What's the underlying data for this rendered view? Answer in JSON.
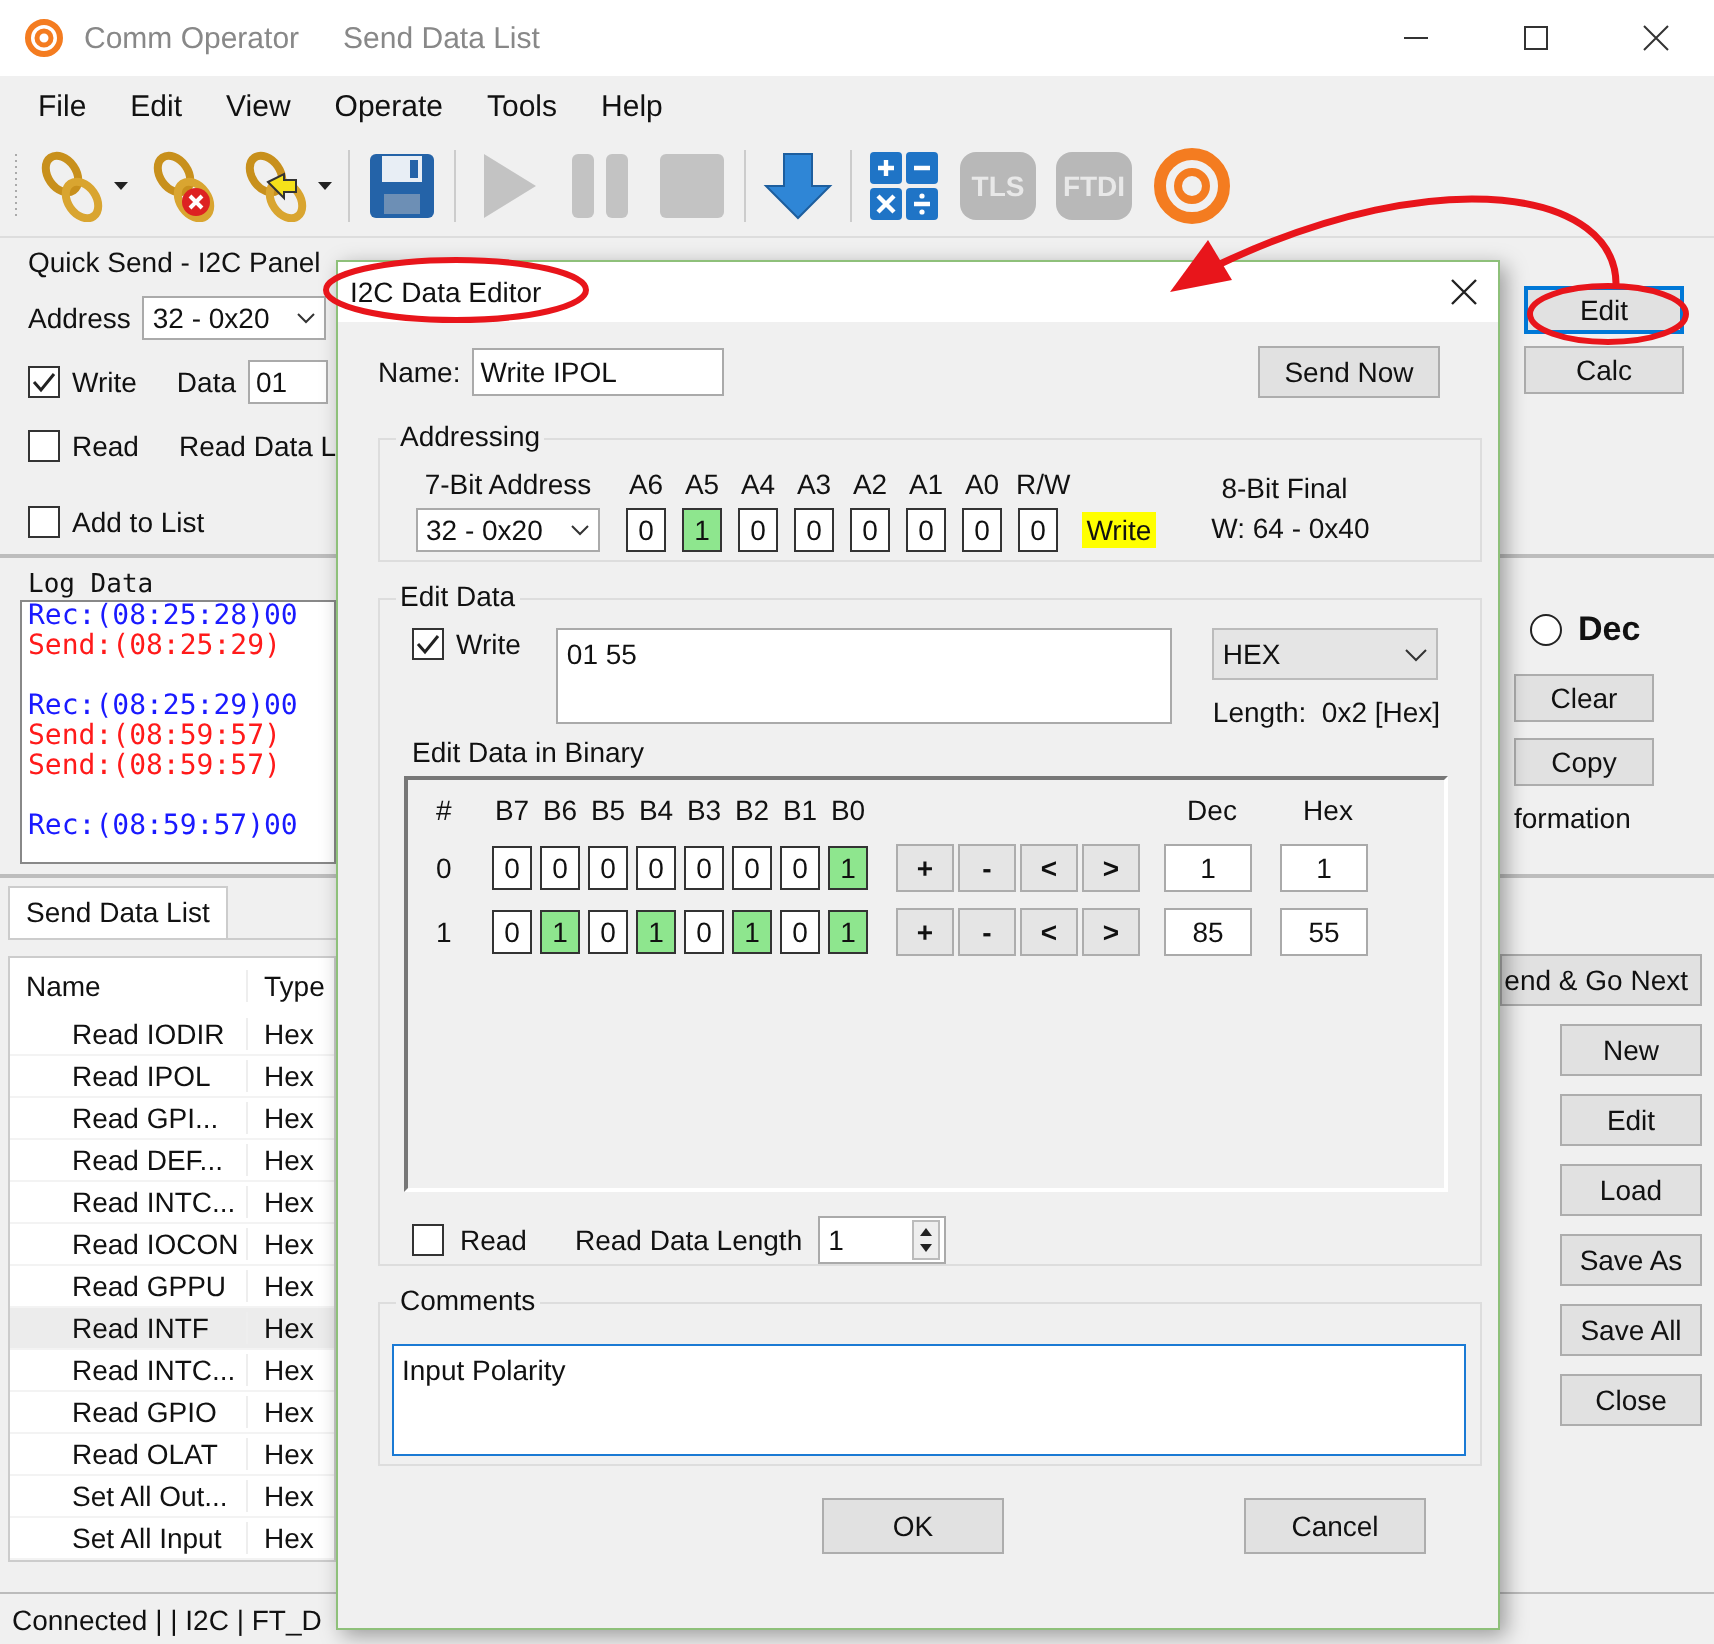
{
  "window": {
    "app_name": "Comm Operator",
    "title": "Send Data List"
  },
  "menu": [
    "File",
    "Edit",
    "View",
    "Operate",
    "Tools",
    "Help"
  ],
  "toolbar": [
    {
      "kind": "connect",
      "dropdown": true,
      "disabled": false
    },
    {
      "kind": "disconnect",
      "dropdown": false,
      "disabled": false
    },
    {
      "kind": "reconnect",
      "dropdown": true,
      "disabled": false
    },
    {
      "kind": "separator"
    },
    {
      "kind": "save",
      "dropdown": false,
      "disabled": false
    },
    {
      "kind": "separator"
    },
    {
      "kind": "play",
      "dropdown": false,
      "disabled": true
    },
    {
      "kind": "pause",
      "dropdown": false,
      "disabled": true
    },
    {
      "kind": "stop",
      "dropdown": false,
      "disabled": true
    },
    {
      "kind": "separator"
    },
    {
      "kind": "download",
      "dropdown": false,
      "disabled": false
    },
    {
      "kind": "separator"
    },
    {
      "kind": "calculator",
      "dropdown": false,
      "disabled": false
    },
    {
      "kind": "badge",
      "label": "TLS",
      "dropdown": false,
      "disabled": true
    },
    {
      "kind": "badge",
      "label": "FTDI",
      "dropdown": false,
      "disabled": true
    },
    {
      "kind": "logo",
      "dropdown": false,
      "disabled": false
    }
  ],
  "quick_send": {
    "title": "Quick Send - I2C Panel",
    "address_label": "Address",
    "address": "32 - 0x20",
    "write": {
      "label": "Write",
      "checked": true
    },
    "data_label": "Data",
    "data": "01",
    "read": {
      "label": "Read",
      "checked": false
    },
    "read_length_label": "Read Data L",
    "add_to_list": {
      "label": "Add to List",
      "checked": false
    }
  },
  "side_buttons": [
    {
      "label": "Edit",
      "focused": true
    },
    {
      "label": "Calc",
      "focused": false
    }
  ],
  "log": {
    "title": "Log Data",
    "lines": [
      {
        "kind": "rec",
        "text": "Rec:(08:25:28)00",
        "gap_before": false
      },
      {
        "kind": "send",
        "text": "Send:(08:25:29)",
        "gap_before": false
      },
      {
        "kind": "rec",
        "text": "Rec:(08:25:29)00",
        "gap_before": true
      },
      {
        "kind": "send",
        "text": "Send:(08:59:57)",
        "gap_before": false
      },
      {
        "kind": "send",
        "text": "Send:(08:59:57)",
        "gap_before": false
      },
      {
        "kind": "rec",
        "text": "Rec:(08:59:57)00",
        "gap_before": true
      }
    ],
    "format": {
      "label": "Dec",
      "selected": false
    },
    "buttons": [
      "Clear",
      "Copy"
    ],
    "info_text": "formation"
  },
  "send_list": {
    "tab": "Send Data List",
    "columns": [
      "Name",
      "Type"
    ],
    "rows": [
      {
        "name": "Read IODIR",
        "type": "Hex",
        "selected": false
      },
      {
        "name": "Read IPOL",
        "type": "Hex",
        "selected": false
      },
      {
        "name": "Read GPI...",
        "type": "Hex",
        "selected": false
      },
      {
        "name": "Read DEF...",
        "type": "Hex",
        "selected": false
      },
      {
        "name": "Read INTC...",
        "type": "Hex",
        "selected": false
      },
      {
        "name": "Read IOCON",
        "type": "Hex",
        "selected": false
      },
      {
        "name": "Read GPPU",
        "type": "Hex",
        "selected": false
      },
      {
        "name": "Read INTF",
        "type": "Hex",
        "selected": true
      },
      {
        "name": "Read INTC...",
        "type": "Hex",
        "selected": false
      },
      {
        "name": "Read GPIO",
        "type": "Hex",
        "selected": false
      },
      {
        "name": "Read OLAT",
        "type": "Hex",
        "selected": false
      },
      {
        "name": "Set All Out...",
        "type": "Hex",
        "selected": false
      },
      {
        "name": "Set All Input",
        "type": "Hex",
        "selected": false
      }
    ],
    "send_next": "end & Go Next",
    "buttons": [
      "New",
      "Edit",
      "Load",
      "Save As",
      "Save All",
      "Close"
    ]
  },
  "status_bar": "Connected | | I2C | FT_D",
  "dialog": {
    "title": "I2C Data Editor",
    "name_label": "Name:",
    "name": "Write IPOL",
    "send_button": "Send Now",
    "addressing": {
      "title": "Addressing",
      "address_label": "7-Bit Address",
      "address": "32 - 0x20",
      "bits": [
        {
          "label": "A6",
          "value": "0",
          "set": false
        },
        {
          "label": "A5",
          "value": "1",
          "set": true
        },
        {
          "label": "A4",
          "value": "0",
          "set": false
        },
        {
          "label": "A3",
          "value": "0",
          "set": false
        },
        {
          "label": "A2",
          "value": "0",
          "set": false
        },
        {
          "label": "A1",
          "value": "0",
          "set": false
        },
        {
          "label": "A0",
          "value": "0",
          "set": false
        },
        {
          "label": "R/W",
          "value": "0",
          "set": false
        }
      ],
      "mode": "Write",
      "final_label": "8-Bit Final",
      "final": "W: 64 - 0x40"
    },
    "edit_data": {
      "title": "Edit Data",
      "write": {
        "label": "Write",
        "checked": true
      },
      "data": "01 55",
      "format": "HEX",
      "length": "Length:  0x2 [Hex]",
      "binary_title": "Edit Data in Binary",
      "headers": [
        "#",
        "B7",
        "B6",
        "B5",
        "B4",
        "B3",
        "B2",
        "B1",
        "B0",
        "Dec",
        "Hex"
      ],
      "rows": [
        {
          "index": "0",
          "bits": [
            {
              "value": "0",
              "set": false
            },
            {
              "value": "0",
              "set": false
            },
            {
              "value": "0",
              "set": false
            },
            {
              "value": "0",
              "set": false
            },
            {
              "value": "0",
              "set": false
            },
            {
              "value": "0",
              "set": false
            },
            {
              "value": "0",
              "set": false
            },
            {
              "value": "1",
              "set": true
            }
          ],
          "step_buttons": [
            "+",
            "-",
            "<",
            ">"
          ],
          "dec": "1",
          "hex": "1"
        },
        {
          "index": "1",
          "bits": [
            {
              "value": "0",
              "set": false
            },
            {
              "value": "1",
              "set": true
            },
            {
              "value": "0",
              "set": false
            },
            {
              "value": "1",
              "set": true
            },
            {
              "value": "0",
              "set": false
            },
            {
              "value": "1",
              "set": true
            },
            {
              "value": "0",
              "set": false
            },
            {
              "value": "1",
              "set": true
            }
          ],
          "step_buttons": [
            "+",
            "-",
            "<",
            ">"
          ],
          "dec": "85",
          "hex": "55"
        }
      ],
      "read": {
        "label": "Read",
        "checked": false
      },
      "read_length_label": "Read Data Length",
      "read_length": "1"
    },
    "comments": {
      "title": "Comments",
      "text": "Input Polarity"
    },
    "buttons": [
      "OK",
      "Cancel"
    ]
  }
}
